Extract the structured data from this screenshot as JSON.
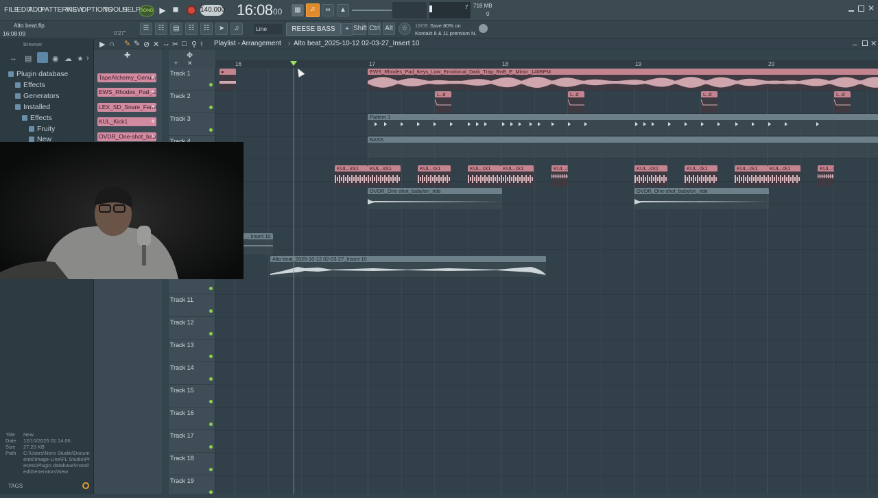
{
  "menu": [
    "FILE",
    "EDIT",
    "ADD",
    "PATTERNS",
    "VIEW",
    "OPTIONS",
    "TOOLS",
    "HELP"
  ],
  "transport": {
    "song_label": "SONG",
    "tempo": "140.000",
    "time": "16:08",
    "time_sub": "00",
    "cpu_label": "7",
    "ram": "718 MB",
    "poly": "0"
  },
  "project": {
    "file": "Alto beat.flp",
    "time": "16:08:09",
    "length": "0'27\""
  },
  "secbar": {
    "snap": "Line",
    "pattern": "REESE BASS",
    "shift": "Shift",
    "ctrl": "Ctrl",
    "alt": "Alt",
    "hint_count": "18/09",
    "hint_title": "Save 80% on",
    "hint_body": "Kontakt 8 & 11 premium N."
  },
  "browser": {
    "title": "Browser",
    "items": [
      {
        "label": "Plugin database",
        "level": 0
      },
      {
        "label": "Effects",
        "level": 1
      },
      {
        "label": "Generators",
        "level": 1
      },
      {
        "label": "Installed",
        "level": 1
      },
      {
        "label": "Effects",
        "level": 2
      },
      {
        "label": "Fruity",
        "level": 3
      },
      {
        "label": "New",
        "level": 3
      }
    ],
    "info": {
      "title_k": "Title",
      "title_v": "New",
      "date_k": "Date",
      "date_v": "12/10/2025 01:14:06",
      "size_k": "Size",
      "size_v": "27.20 KB",
      "path_k": "Path",
      "path_v": "C:\\Users\\Nero Studio\\Documents\\Image-Line\\FL Studio\\Presets\\Plugin database\\Installed\\Generators\\New"
    },
    "tags": "TAGS"
  },
  "playlist": {
    "title": "Playlist - Arrangement",
    "crumb": "Alto beat_2025-10-12 02-03-27_Insert 10",
    "ruler": [
      "16",
      "17",
      "18",
      "19",
      "20"
    ]
  },
  "channels": [
    "TapeAlchemy_Genuin..",
    "EWS_Rhodes_Pad_Ke..",
    "LEX_SD_Snare_Ferm..",
    "KUL_Kick1",
    "OVDR_One-shot_bab.."
  ],
  "tracks": [
    "Track 1",
    "Track 2",
    "Track 3",
    "Track 4",
    "",
    "",
    "",
    "",
    "",
    "Track 10",
    "Track 11",
    "Track 12",
    "Track 13",
    "Track 14",
    "Track 15",
    "Track 16",
    "Track 17",
    "Track 18",
    "Track 19"
  ],
  "clips": {
    "rhodes": "EWS_Rhodes_Pad_Keys_Low_Emotional_Dark_Trap_RnB_E_Minor_140BPM",
    "pattern1": "Pattern 1",
    "bass": "BASS",
    "kick": "KUL..ick1",
    "kick2": "KUL..ck1",
    "ovdr": "OVDR_One-shot_babylon_ride",
    "insert_short": "_..Insert 10",
    "insert_long": "Alto beat_2025-10-12 02-03-27_Insert 10",
    "snare": "L..d"
  },
  "colors": {
    "clip_pink": "#c4848f",
    "clip_grey": "#6d7f88",
    "accent_orange": "#f0a030",
    "track_dot": "#8fd14f"
  }
}
